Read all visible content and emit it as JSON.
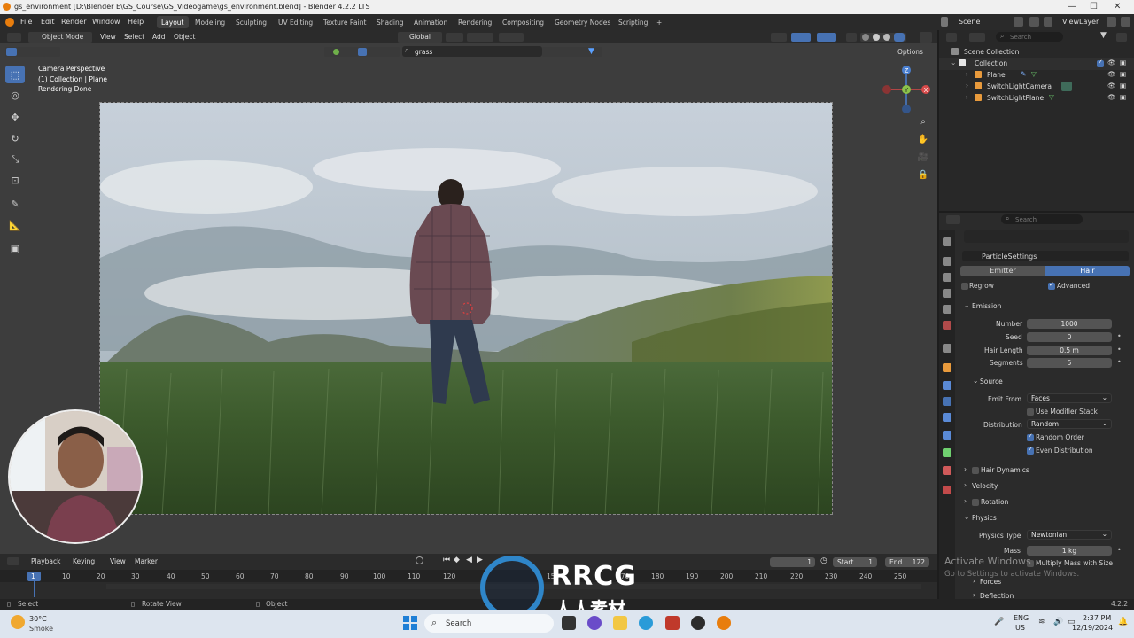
{
  "window": {
    "title": "gs_environment [D:\\Blender E\\GS_Course\\GS_Videogame\\gs_environment.blend] - Blender 4.2.2 LTS",
    "minimize": "—",
    "maximize": "☐",
    "close": "✕"
  },
  "menubar": {
    "items": [
      "File",
      "Edit",
      "Render",
      "Window",
      "Help"
    ],
    "workspaces": [
      "Layout",
      "Modeling",
      "Sculpting",
      "UV Editing",
      "Texture Paint",
      "Shading",
      "Animation",
      "Rendering",
      "Compositing",
      "Geometry Nodes",
      "Scripting"
    ],
    "active_workspace": "Layout",
    "add_tab": "+",
    "scene": "Scene",
    "view_layer": "ViewLayer"
  },
  "viewport_header": {
    "mode": "Object Mode",
    "menus": [
      "View",
      "Select",
      "Add",
      "Object"
    ],
    "transform": "Global",
    "search_value": "grass",
    "options": "Options"
  },
  "viewport": {
    "info_line1": "Camera Perspective",
    "info_line2": "(1) Collection | Plane",
    "info_line3": "Rendering Done",
    "gizmo_labels": {
      "z": "Z",
      "y": "Y",
      "x": "X"
    }
  },
  "outliner": {
    "search_placeholder": "Search",
    "root": "Scene Collection",
    "collection": "Collection",
    "objects": [
      "Plane",
      "SwitchLightCamera",
      "SwitchLightPlane"
    ]
  },
  "properties": {
    "search_placeholder": "Search",
    "particle_settings": "ParticleSettings",
    "tabs": [
      "Emitter",
      "Hair"
    ],
    "active_tab": "Hair",
    "regrow_label": "Regrow",
    "advanced_label": "Advanced",
    "emission": {
      "header": "Emission",
      "number_label": "Number",
      "number": "1000",
      "seed_label": "Seed",
      "seed": "0",
      "hair_length_label": "Hair Length",
      "hair_length": "0.5 m",
      "segments_label": "Segments",
      "segments": "5"
    },
    "source": {
      "header": "Source",
      "emit_from_label": "Emit From",
      "emit_from": "Faces",
      "use_modifier_stack": "Use Modifier Stack",
      "distribution_label": "Distribution",
      "distribution": "Random",
      "random_order": "Random Order",
      "even_distribution": "Even Distribution"
    },
    "sections": [
      "Hair Dynamics",
      "Velocity",
      "Rotation"
    ],
    "physics": {
      "header": "Physics",
      "type_label": "Physics Type",
      "type": "Newtonian",
      "mass_label": "Mass",
      "mass": "1 kg",
      "multiply_mass": "Multiply Mass with Size",
      "forces": "Forces",
      "deflection": "Deflection"
    }
  },
  "timeline": {
    "menus": [
      "Playback",
      "Keying",
      "View",
      "Marker"
    ],
    "current_frame": "1",
    "start_label": "Start",
    "start": "1",
    "end_label": "End",
    "end": "122",
    "ticks": [
      "1",
      "10",
      "20",
      "30",
      "40",
      "50",
      "60",
      "70",
      "80",
      "90",
      "100",
      "110",
      "120",
      "150",
      "170",
      "180",
      "190",
      "200",
      "210",
      "220",
      "230",
      "240",
      "250"
    ]
  },
  "statusbar": {
    "select": "Select",
    "rotate_view": "Rotate View",
    "object": "Object",
    "version": "4.2.2"
  },
  "activation": {
    "line1": "Activate Windows",
    "line2": "Go to Settings to activate Windows."
  },
  "taskbar": {
    "weather_temp": "30°C",
    "weather_desc": "Smoke",
    "search": "Search",
    "lang1": "ENG",
    "lang2": "US",
    "time": "2:37 PM",
    "date": "12/19/2024"
  },
  "watermark": {
    "brand": "RRCG",
    "sub": "人人素材"
  },
  "colors": {
    "accent": "#4772b3",
    "blender_orange": "#e87d0d"
  }
}
